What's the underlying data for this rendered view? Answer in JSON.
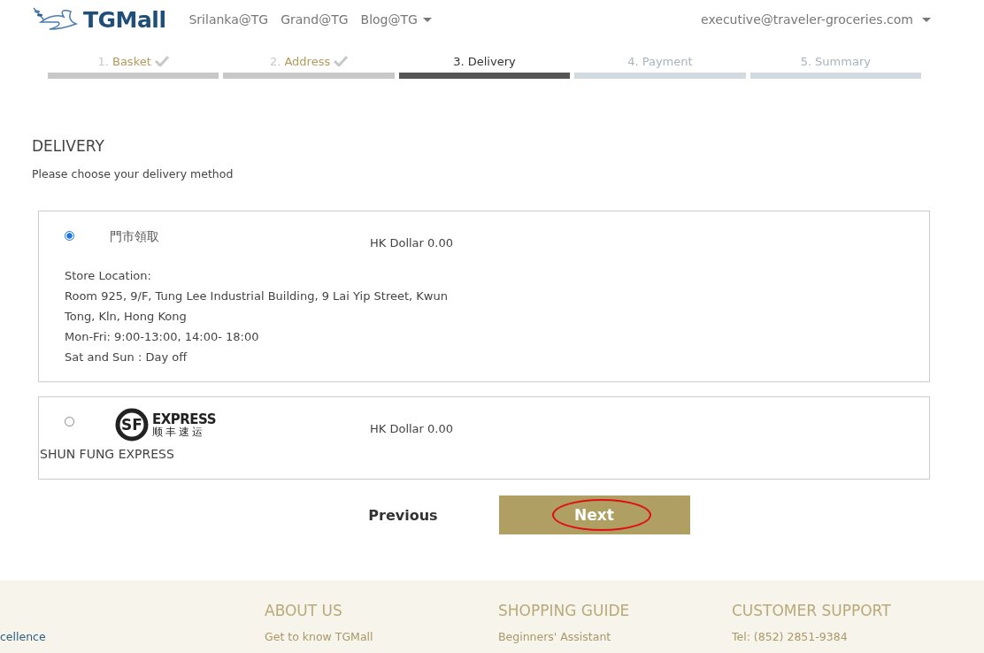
{
  "header": {
    "logo": "TGMall",
    "nav": [
      {
        "label": "Srilanka@TG",
        "dropdown": false
      },
      {
        "label": "Grand@TG",
        "dropdown": false
      },
      {
        "label": "Blog@TG",
        "dropdown": true
      }
    ],
    "account": "executive@traveler-groceries.com"
  },
  "steps": [
    {
      "number": "1.",
      "label": "Basket",
      "completed": true,
      "current": false
    },
    {
      "number": "2.",
      "label": "Address",
      "completed": true,
      "current": false
    },
    {
      "number": "3.",
      "label": "Delivery",
      "completed": false,
      "current": true
    },
    {
      "number": "4.",
      "label": "Payment",
      "completed": false,
      "current": false
    },
    {
      "number": "5.",
      "label": "Summary",
      "completed": false,
      "current": false
    }
  ],
  "delivery": {
    "title": "DELIVERY",
    "subtitle": "Please choose your delivery method",
    "options": [
      {
        "kind": "pickup",
        "selected": true,
        "name": "門市領取",
        "price": "HK Dollar 0.00",
        "details": [
          "Store Location:",
          "Room 925, 9/F, Tung Lee Industrial Building, 9 Lai Yip Street, Kwun Tong, Kln, Hong Kong",
          "Mon-Fri: 9:00-13:00, 14:00- 18:00",
          "Sat and Sun : Day off"
        ]
      },
      {
        "kind": "courier",
        "selected": false,
        "logo_emblem": "SF",
        "logo_text": "EXPRESS",
        "logo_subtext": "顺丰速运",
        "name": "SHUN FUNG EXPRESS",
        "price": "HK Dollar 0.00"
      }
    ]
  },
  "buttons": {
    "previous": "Previous",
    "next": "Next"
  },
  "footer": {
    "cut_text": "cellence",
    "columns": [
      {
        "heading": "ABOUT US",
        "link": "Get to know TGMall"
      },
      {
        "heading": "SHOPPING GUIDE",
        "link": "Beginners' Assistant"
      },
      {
        "heading": "CUSTOMER SUPPORT",
        "link": "Tel: (852) 2851-9384"
      }
    ]
  }
}
